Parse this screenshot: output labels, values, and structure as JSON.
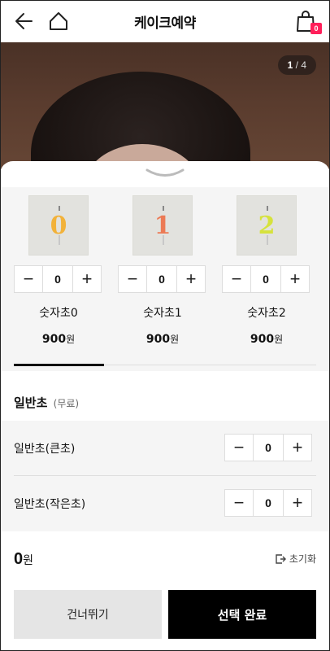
{
  "header": {
    "title": "케이크예약",
    "cart_count": "0"
  },
  "hero": {
    "page_current": "1",
    "page_total": "/ 4"
  },
  "candles": [
    {
      "digit": "0",
      "color": "#f2b23a",
      "qty": "0",
      "name": "숫자초0",
      "price": "900",
      "unit": "원"
    },
    {
      "digit": "1",
      "color": "#ec7a55",
      "qty": "0",
      "name": "숫자초1",
      "price": "900",
      "unit": "원"
    },
    {
      "digit": "2",
      "color": "#d6e23c",
      "qty": "0",
      "name": "숫자초2",
      "price": "900",
      "unit": "원"
    }
  ],
  "stepper": {
    "minus": "−",
    "plus": "+"
  },
  "plain": {
    "title": "일반초",
    "note": "(무료)",
    "rows": [
      {
        "label": "일반초(큰초)",
        "qty": "0"
      },
      {
        "label": "일반초(작은초)",
        "qty": "0"
      }
    ]
  },
  "footer": {
    "total_amount": "0",
    "total_unit": "원",
    "reset_label": "초기화",
    "skip_label": "건너뛰기",
    "done_label": "선택 완료"
  }
}
